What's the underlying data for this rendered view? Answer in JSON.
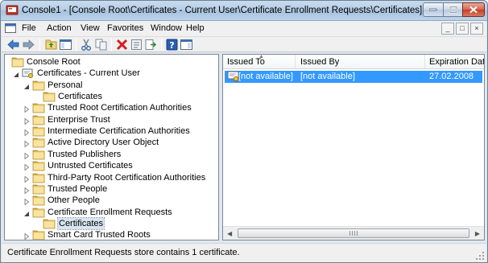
{
  "window": {
    "title": "Console1 - [Console Root\\Certificates - Current User\\Certificate Enrollment Requests\\Certificates]"
  },
  "menu": {
    "items": [
      "File",
      "Action",
      "View",
      "Favorites",
      "Window",
      "Help"
    ],
    "mdi_buttons": [
      "_",
      "□",
      "×"
    ]
  },
  "toolbar": {
    "icons": [
      "back-icon",
      "forward-icon",
      "up-folder-icon",
      "show-hide-tree-icon",
      "cut-icon",
      "copy-icon",
      "delete-icon",
      "properties-icon",
      "export-list-icon",
      "help-icon",
      "show-hide-action-pane-icon"
    ]
  },
  "tree": {
    "items": [
      {
        "label": "Console Root",
        "icon": "folder-icon"
      },
      {
        "label": "Certificates - Current User",
        "icon": "certificates-snapin-icon"
      },
      {
        "label": "Personal",
        "icon": "folder-icon"
      },
      {
        "label": "Certificates",
        "icon": "folder-icon"
      },
      {
        "label": "Trusted Root Certification Authorities",
        "icon": "folder-icon"
      },
      {
        "label": "Enterprise Trust",
        "icon": "folder-icon"
      },
      {
        "label": "Intermediate Certification Authorities",
        "icon": "folder-icon"
      },
      {
        "label": "Active Directory User Object",
        "icon": "folder-icon"
      },
      {
        "label": "Trusted Publishers",
        "icon": "folder-icon"
      },
      {
        "label": "Untrusted Certificates",
        "icon": "folder-icon"
      },
      {
        "label": "Third-Party Root Certification Authorities",
        "icon": "folder-icon"
      },
      {
        "label": "Trusted People",
        "icon": "folder-icon"
      },
      {
        "label": "Other People",
        "icon": "folder-icon"
      },
      {
        "label": "Certificate Enrollment Requests",
        "icon": "folder-icon"
      },
      {
        "label": "Certificates",
        "icon": "folder-icon"
      },
      {
        "label": "Smart Card Trusted Roots",
        "icon": "folder-icon"
      }
    ]
  },
  "list": {
    "columns": [
      "Issued To",
      "Issued By",
      "Expiration Date"
    ],
    "rows": [
      {
        "issued_to": "[not available]",
        "issued_by": "[not available]",
        "expiration": "27.02.2008",
        "icon": "certificate-icon"
      }
    ]
  },
  "status": {
    "text": "Certificate Enrollment Requests store contains 1 certificate."
  },
  "colors": {
    "selection": "#3399ff",
    "folder": "#f5d67b",
    "title_bar": "#b5cde6"
  }
}
